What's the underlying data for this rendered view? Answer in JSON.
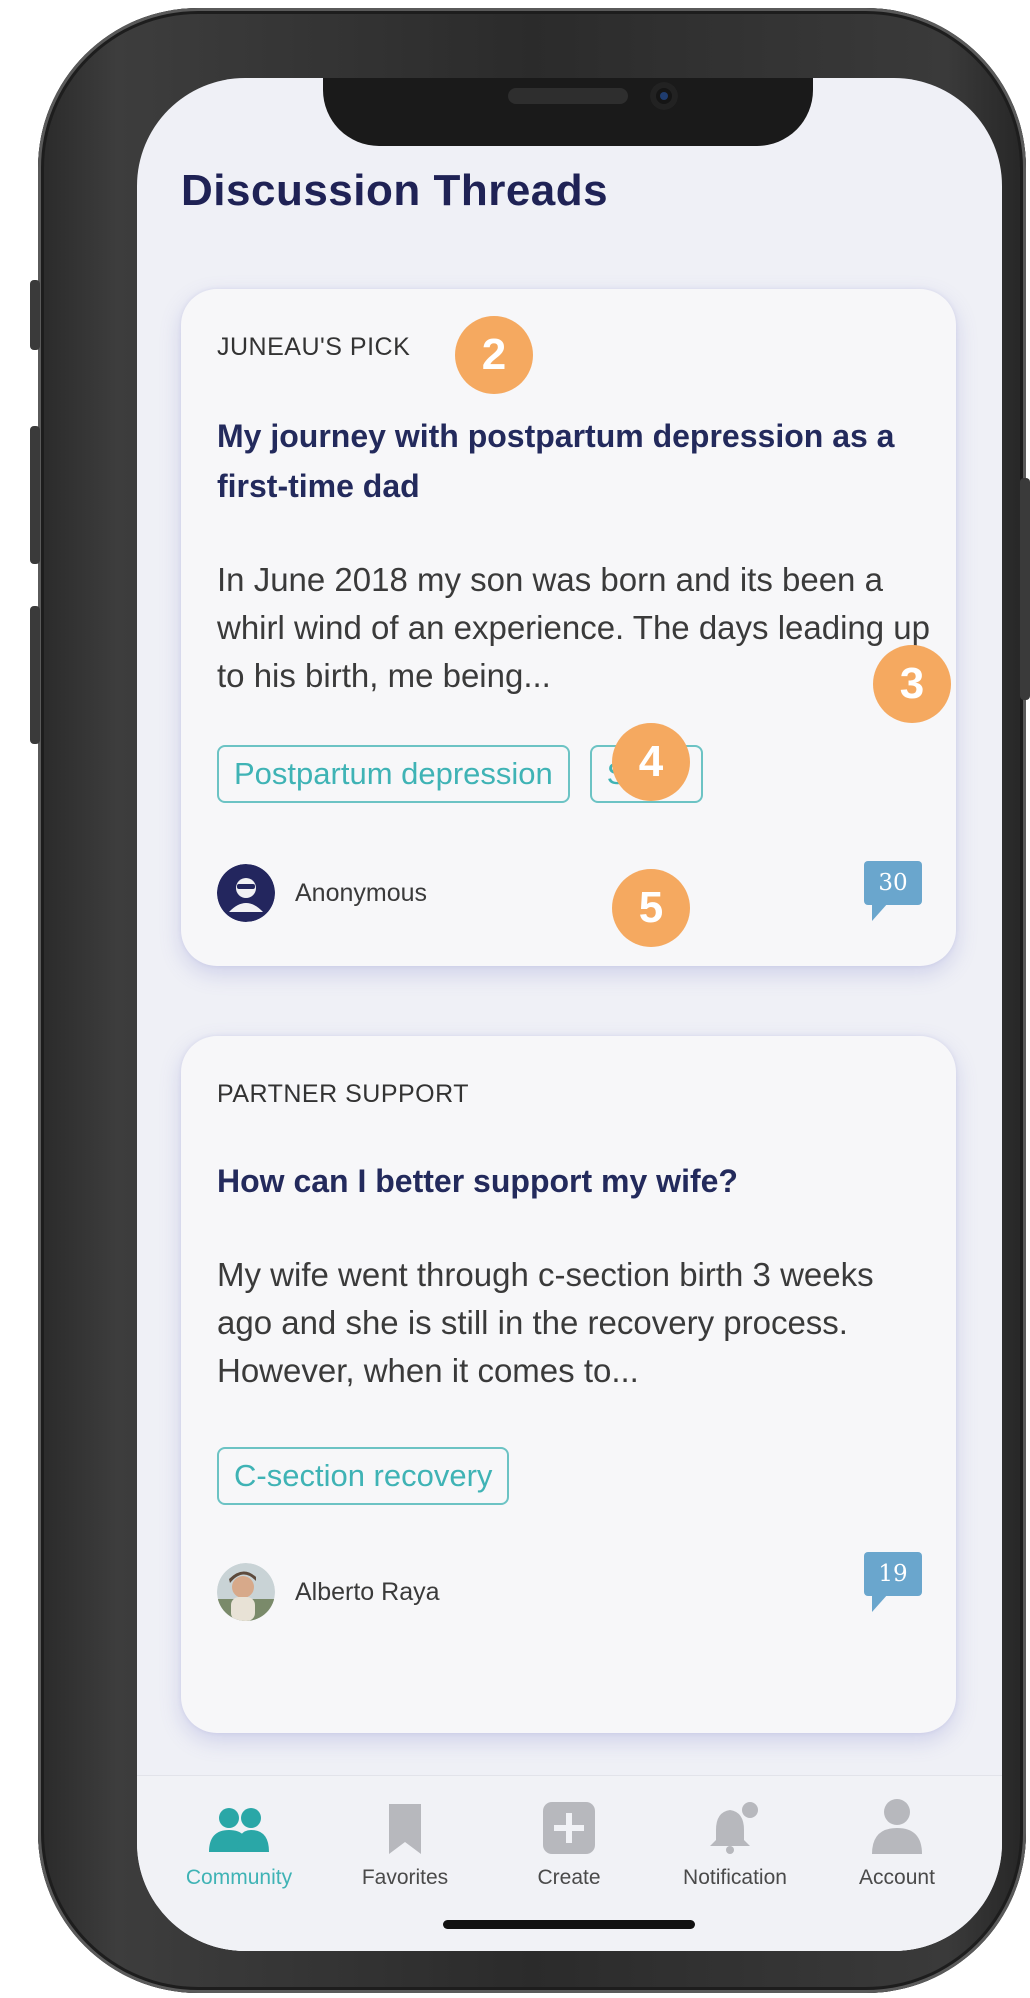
{
  "screen": {
    "title": "Discussion Threads"
  },
  "threads": [
    {
      "category": "JUNEAU'S PICK",
      "title": "My journey with postpartum depression as a first-time dad",
      "excerpt": "In June 2018 my son was born and its been a whirl wind of an experience. The days leading up to his birth, me being...",
      "tags": [
        "Postpartum depression",
        "Sleep"
      ],
      "author": "Anonymous",
      "comments": "30"
    },
    {
      "category": "PARTNER SUPPORT",
      "title": "How can I better support my wife?",
      "excerpt": "My wife went through c-section birth 3 weeks ago and she is still in the recovery process. However, when it comes to...",
      "tags": [
        "C-section recovery"
      ],
      "author": "Alberto Raya",
      "comments": "19"
    }
  ],
  "markers": [
    "2",
    "3",
    "4",
    "5"
  ],
  "tabbar": {
    "tabs": [
      {
        "label": "Community",
        "icon": "community-icon",
        "active": true
      },
      {
        "label": "Favorites",
        "icon": "bookmark-icon",
        "active": false
      },
      {
        "label": "Create",
        "icon": "plus-square-icon",
        "active": false
      },
      {
        "label": "Notification",
        "icon": "bell-icon",
        "active": false
      },
      {
        "label": "Account",
        "icon": "user-icon",
        "active": false
      }
    ]
  },
  "colors": {
    "title": "#1f2255",
    "accent": "#3fb3b5",
    "comment_bubble": "#6aa6cd",
    "marker": "#f5a960",
    "background": "#eff0f6"
  }
}
